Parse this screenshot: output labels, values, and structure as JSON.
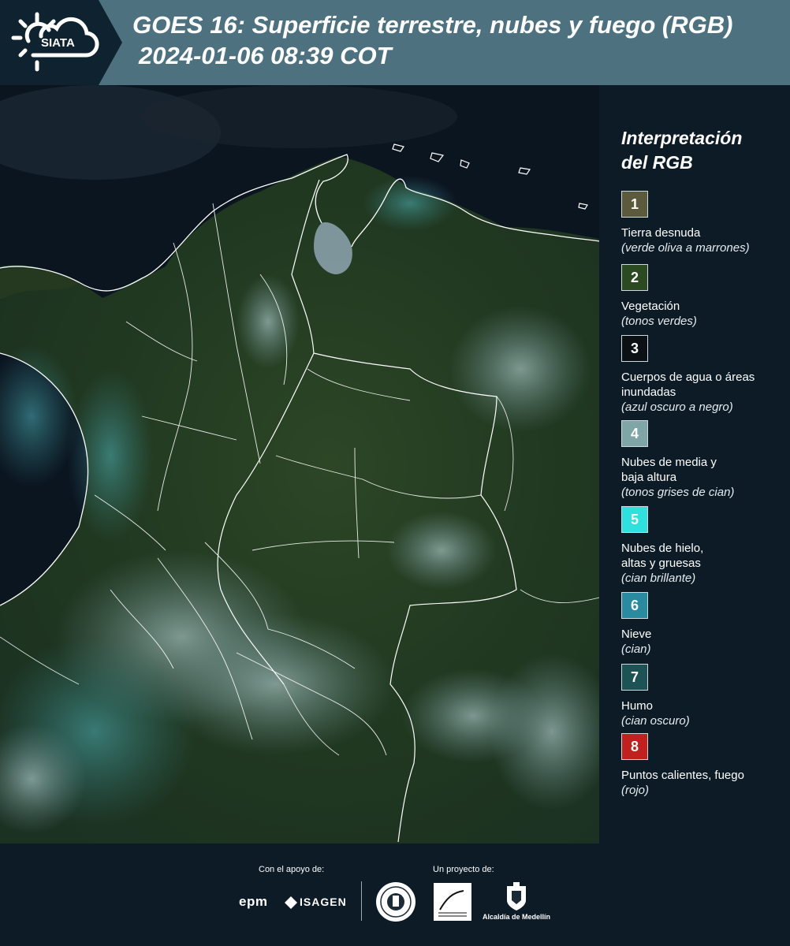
{
  "header": {
    "logo_text": "SIATA",
    "title_line1": "GOES 16: Superficie terrestre, nubes y fuego (RGB)",
    "title_line2": "2024-01-06 08:39 COT"
  },
  "legend": {
    "title_line1": "Interpretación",
    "title_line2": "del RGB",
    "items": [
      {
        "number": "1",
        "label": "Tierra desnuda",
        "sub": "(verde oliva a marrones)",
        "color": "#5b5a3d"
      },
      {
        "number": "2",
        "label": "Vegetación",
        "sub": "(tonos verdes)",
        "color": "#2c4a22"
      },
      {
        "number": "3",
        "label": "Cuerpos de agua o áreas inundadas",
        "sub": "(azul oscuro a negro)",
        "color": "#0b1014"
      },
      {
        "number": "4",
        "label": "Nubes de media y baja altura",
        "sub": "(tonos grises de cian)",
        "color": "#7fa5a6"
      },
      {
        "number": "5",
        "label": "Nubes de hielo, altas y gruesas",
        "sub": "(cian brillante)",
        "color": "#2ee0de"
      },
      {
        "number": "6",
        "label": "Nieve",
        "sub": "(cian)",
        "color": "#2a8aa0"
      },
      {
        "number": "7",
        "label": "Humo",
        "sub": "(cian oscuro)",
        "color": "#1e5355"
      },
      {
        "number": "8",
        "label": "Puntos calientes, fuego",
        "sub": "(rojo)",
        "color": "#c0201e"
      }
    ]
  },
  "footer": {
    "support_label": "Con el apoyo de:",
    "project_label": "Un proyecto de:",
    "sponsor1": "epm",
    "sponsor2": "ISAGEN",
    "partner_alcaldia": "Alcaldía de Medellín"
  },
  "colors": {
    "header_bg": "#4e7180",
    "logo_bg": "#0f2230",
    "page_bg": "#0d1b26",
    "map_ocean": "#0b1520",
    "map_land": "#23391f",
    "border_lines": "#ffffff"
  }
}
